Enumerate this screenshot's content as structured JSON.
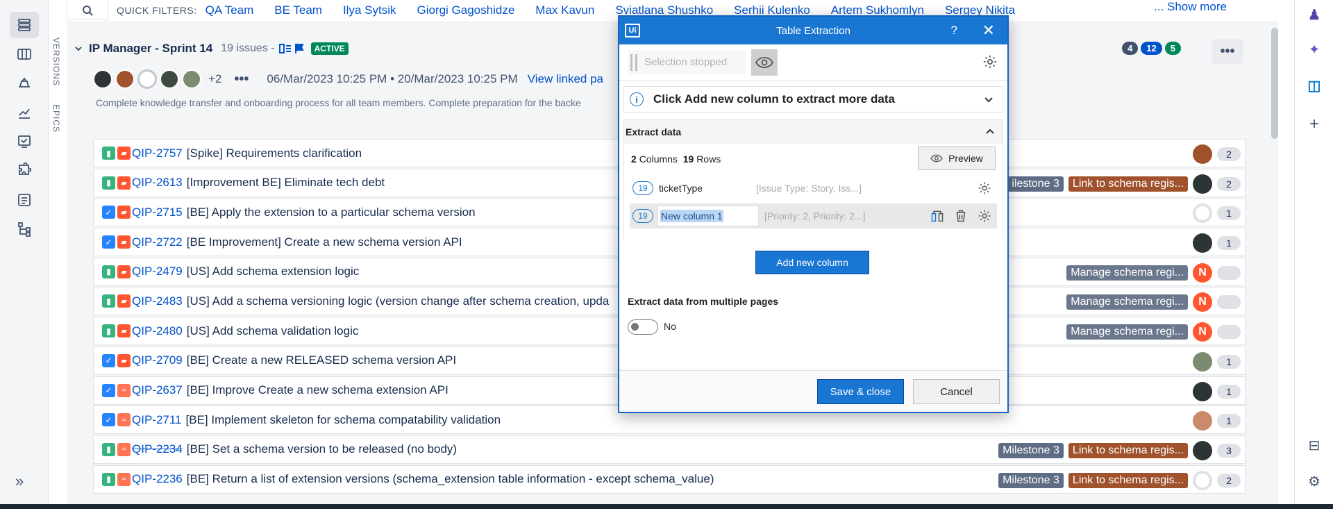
{
  "quick_filters": {
    "label": "QUICK FILTERS:",
    "items": [
      "QA Team",
      "BE Team",
      "Ilya Sytsik",
      "Giorgi Gagoshidze",
      "Max Kavun",
      "Sviatlana Shushko",
      "Serhii Kulenko",
      "Artem Sukhomlyn",
      "Sergey Nikita"
    ],
    "show_more": "... Show more"
  },
  "vertical_tabs": [
    "VERSIONS",
    "EPICS"
  ],
  "sprint": {
    "title": "IP Manager - Sprint 14",
    "issue_count": "19 issues -",
    "status": "ACTIVE",
    "extra_members": "+2",
    "dates": "06/Mar/2023 10:25 PM • 20/Mar/2023 10:25 PM",
    "view_linked": "View linked pa",
    "goal": "Complete knowledge transfer and onboarding process for all team members. Complete preparation for the backe",
    "counts": [
      {
        "value": "4",
        "color": "#42526e"
      },
      {
        "value": "12",
        "color": "#0052cc"
      },
      {
        "value": "5",
        "color": "#00875a"
      }
    ]
  },
  "issues": [
    {
      "type": "story",
      "priority": "high",
      "key": "QIP-2757",
      "summary": "[Spike] Requirements clarification",
      "struck": false,
      "labels": [],
      "assignee": "photo",
      "assignee_color": "#a0522d",
      "points": "2"
    },
    {
      "type": "story",
      "priority": "high",
      "key": "QIP-2613",
      "summary": "[Improvement BE] Eliminate tech debt",
      "struck": false,
      "labels": [
        {
          "text": "ilestone 3",
          "kind": "ms"
        },
        {
          "text": "Link to schema regis...",
          "kind": "link"
        }
      ],
      "assignee": "photo",
      "assignee_color": "#2d3436",
      "points": "2"
    },
    {
      "type": "task",
      "priority": "high",
      "key": "QIP-2715",
      "summary": "[BE] Apply the extension to a particular schema version",
      "struck": false,
      "labels": [],
      "assignee": "empty",
      "assignee_color": "#dfe1e6",
      "points": "1"
    },
    {
      "type": "task",
      "priority": "high",
      "key": "QIP-2722",
      "summary": "[BE Improvement] Create a new schema version API",
      "struck": false,
      "labels": [],
      "assignee": "photo",
      "assignee_color": "#2d3436",
      "points": "1"
    },
    {
      "type": "story",
      "priority": "high",
      "key": "QIP-2479",
      "summary": "[US] Add schema extension logic",
      "struck": false,
      "labels": [
        {
          "text": "Manage schema regi...",
          "kind": "manage"
        }
      ],
      "assignee": "N",
      "assignee_color": "#ff5630",
      "points": ""
    },
    {
      "type": "story",
      "priority": "high",
      "key": "QIP-2483",
      "summary": "[US] Add a schema versioning logic (version change after schema creation, upda",
      "struck": false,
      "labels": [
        {
          "text": "Manage schema regi...",
          "kind": "manage"
        }
      ],
      "assignee": "N",
      "assignee_color": "#ff5630",
      "points": ""
    },
    {
      "type": "story",
      "priority": "high",
      "key": "QIP-2480",
      "summary": "[US] Add schema validation logic",
      "struck": false,
      "labels": [
        {
          "text": "Manage schema regi...",
          "kind": "manage"
        }
      ],
      "assignee": "N",
      "assignee_color": "#ff5630",
      "points": ""
    },
    {
      "type": "task",
      "priority": "high",
      "key": "QIP-2709",
      "summary": "[BE] Create a new RELEASED schema version API",
      "struck": false,
      "labels": [],
      "assignee": "photo",
      "assignee_color": "#7a8b6f",
      "points": "1"
    },
    {
      "type": "task",
      "priority": "low",
      "key": "QIP-2637",
      "summary": "[BE] Improve Create a new schema extension API",
      "struck": false,
      "labels": [],
      "assignee": "photo",
      "assignee_color": "#2d3436",
      "points": "1"
    },
    {
      "type": "task",
      "priority": "low",
      "key": "QIP-2711",
      "summary": "[BE] Implement skeleton for schema compatability validation",
      "struck": false,
      "labels": [],
      "assignee": "photo",
      "assignee_color": "#c98b6b",
      "points": "1"
    },
    {
      "type": "story",
      "priority": "low",
      "key": "QIP-2234",
      "summary": "[BE] Set a schema version to be released (no body)",
      "struck": true,
      "labels": [
        {
          "text": "Milestone 3",
          "kind": "ms"
        },
        {
          "text": "Link to schema regis...",
          "kind": "link"
        }
      ],
      "assignee": "photo",
      "assignee_color": "#2d3436",
      "points": "3"
    },
    {
      "type": "story",
      "priority": "low",
      "key": "QIP-2236",
      "summary": "[BE] Return a list of extension versions (schema_extension table information - except schema_value)",
      "struck": false,
      "labels": [
        {
          "text": "Milestone 3",
          "kind": "ms"
        },
        {
          "text": "Link to schema regis...",
          "kind": "link"
        }
      ],
      "assignee": "empty",
      "assignee_color": "#dfe1e6",
      "points": "2"
    }
  ],
  "dialog": {
    "title": "Table Extraction",
    "logo": "Ui",
    "help": "?",
    "selection_status": "Selection stopped",
    "info": "Click Add new column to extract more data",
    "extract_header": "Extract data",
    "columns_count": "2",
    "columns_word": "Columns",
    "rows_count": "19",
    "rows_word": "Rows",
    "preview": "Preview",
    "columns": [
      {
        "count": "19",
        "name": "ticketType",
        "sample": "[Issue Type: Story, Iss...]"
      },
      {
        "count": "19",
        "name": "New column 1",
        "sample": "[Priority: 2, Priority: 2...]"
      }
    ],
    "add_column": "Add new column",
    "multi_pages_label": "Extract data from multiple pages",
    "multi_pages_value": "No",
    "save": "Save & close",
    "cancel": "Cancel"
  }
}
